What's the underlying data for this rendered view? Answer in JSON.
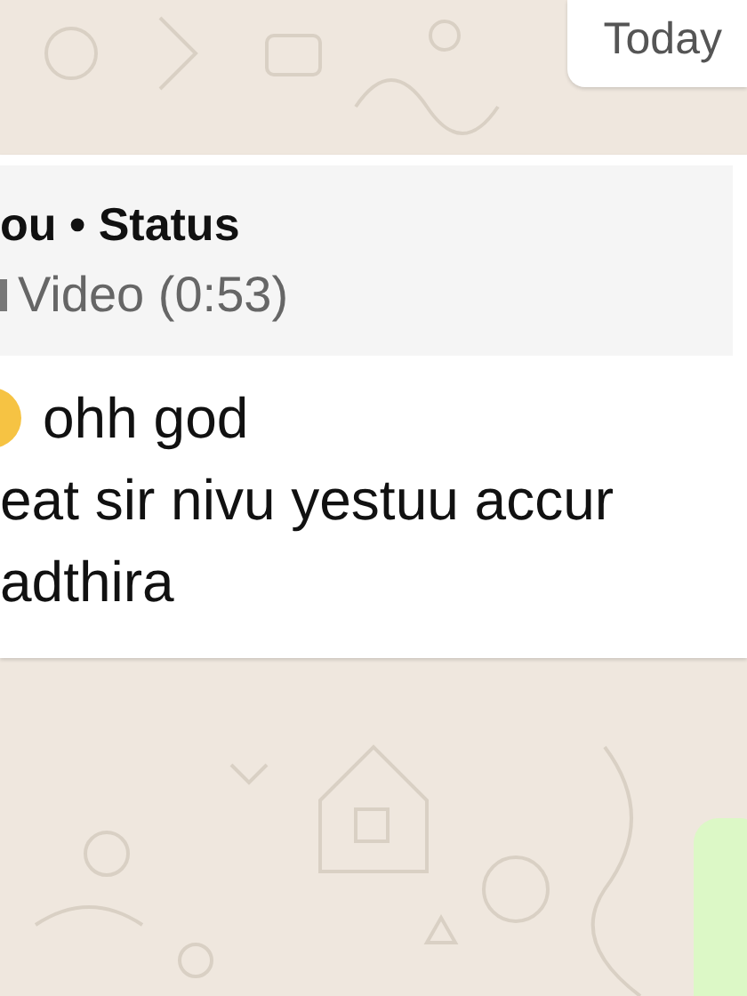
{
  "date_chip": "Today",
  "message": {
    "quote": {
      "sender": "ou • Status",
      "media": "Video (0:53)"
    },
    "lines": [
      {
        "kind": "emoji",
        "text": "ohh god"
      },
      {
        "kind": "plain",
        "text": "eat sir nivu yestuu accur"
      },
      {
        "kind": "plain",
        "text": "adthira"
      }
    ]
  }
}
